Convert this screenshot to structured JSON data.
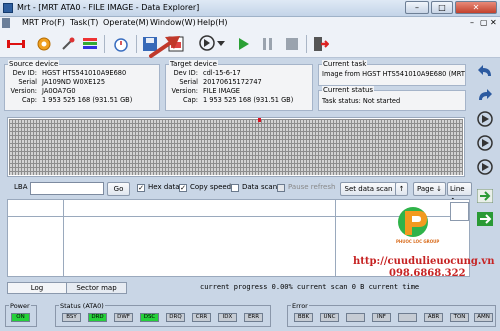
{
  "window": {
    "title": "Mrt - [MRT ATA0 - FILE IMAGE - Data Explorer]"
  },
  "menu": [
    "MRT Pro(F)",
    "Task(T)",
    "Operate(M)",
    "Window(W)",
    "Help(H)"
  ],
  "source": {
    "legend": "Source device",
    "rows": [
      {
        "label": "Dev ID:",
        "value": "HGST HTS541010A9E680"
      },
      {
        "label": "Serial",
        "value": "JA109ND W0XE125"
      },
      {
        "label": "Version:",
        "value": "JA0OA7G0"
      },
      {
        "label": "Cap:",
        "value": "1 953 525 168 (931.51 GB)"
      }
    ]
  },
  "target": {
    "legend": "Target device",
    "rows": [
      {
        "label": "Dev ID:",
        "value": "cdl-15-6-17"
      },
      {
        "label": "Serial",
        "value": "20170615172747"
      },
      {
        "label": "Version:",
        "value": "FILE IMAGE"
      },
      {
        "label": "Cap:",
        "value": "1 953 525 168 (931.51 GB)"
      }
    ]
  },
  "current_task": {
    "legend": "Current task",
    "text": "Image from HGST HTS541010A9E680 (MRT A"
  },
  "current_status": {
    "legend": "Current status",
    "text": "Task status: Not started"
  },
  "controls": {
    "lba_label": "LBA",
    "lba_value": "",
    "go": "Go",
    "hex_data": "Hex data",
    "copy_speed": "Copy speed",
    "data_scan": "Data scan",
    "pause_refresh": "Pause refresh",
    "set_data_scan": "Set data scan",
    "page_btn": "Page",
    "line_btn": "Line"
  },
  "tabs": {
    "log": "Log",
    "sector_map": "Sector map"
  },
  "status_line": "current progress 0.00% current scan  0 B  current time",
  "groups": {
    "power": {
      "label": "Power",
      "items": [
        "ON"
      ]
    },
    "status": {
      "label": "Status (ATA0)",
      "items": [
        "BSY",
        "DRD",
        "DWF",
        "DSC",
        "DRQ",
        "CRR",
        "IDX",
        "ERR"
      ]
    },
    "error": {
      "label": "Error",
      "items": [
        "BBK",
        "UNC",
        "",
        "INF",
        "",
        "ABR",
        "TON",
        "AMN"
      ]
    }
  },
  "watermark": {
    "url": "http://cuudulieuocung.vn",
    "phone": "098.6868.322",
    "brand": "PHUOC LOC GROUP"
  },
  "colors": {
    "on_green": "#25d13a",
    "arrow_red": "#c0392b",
    "accent_blue": "#2c5aa0"
  }
}
